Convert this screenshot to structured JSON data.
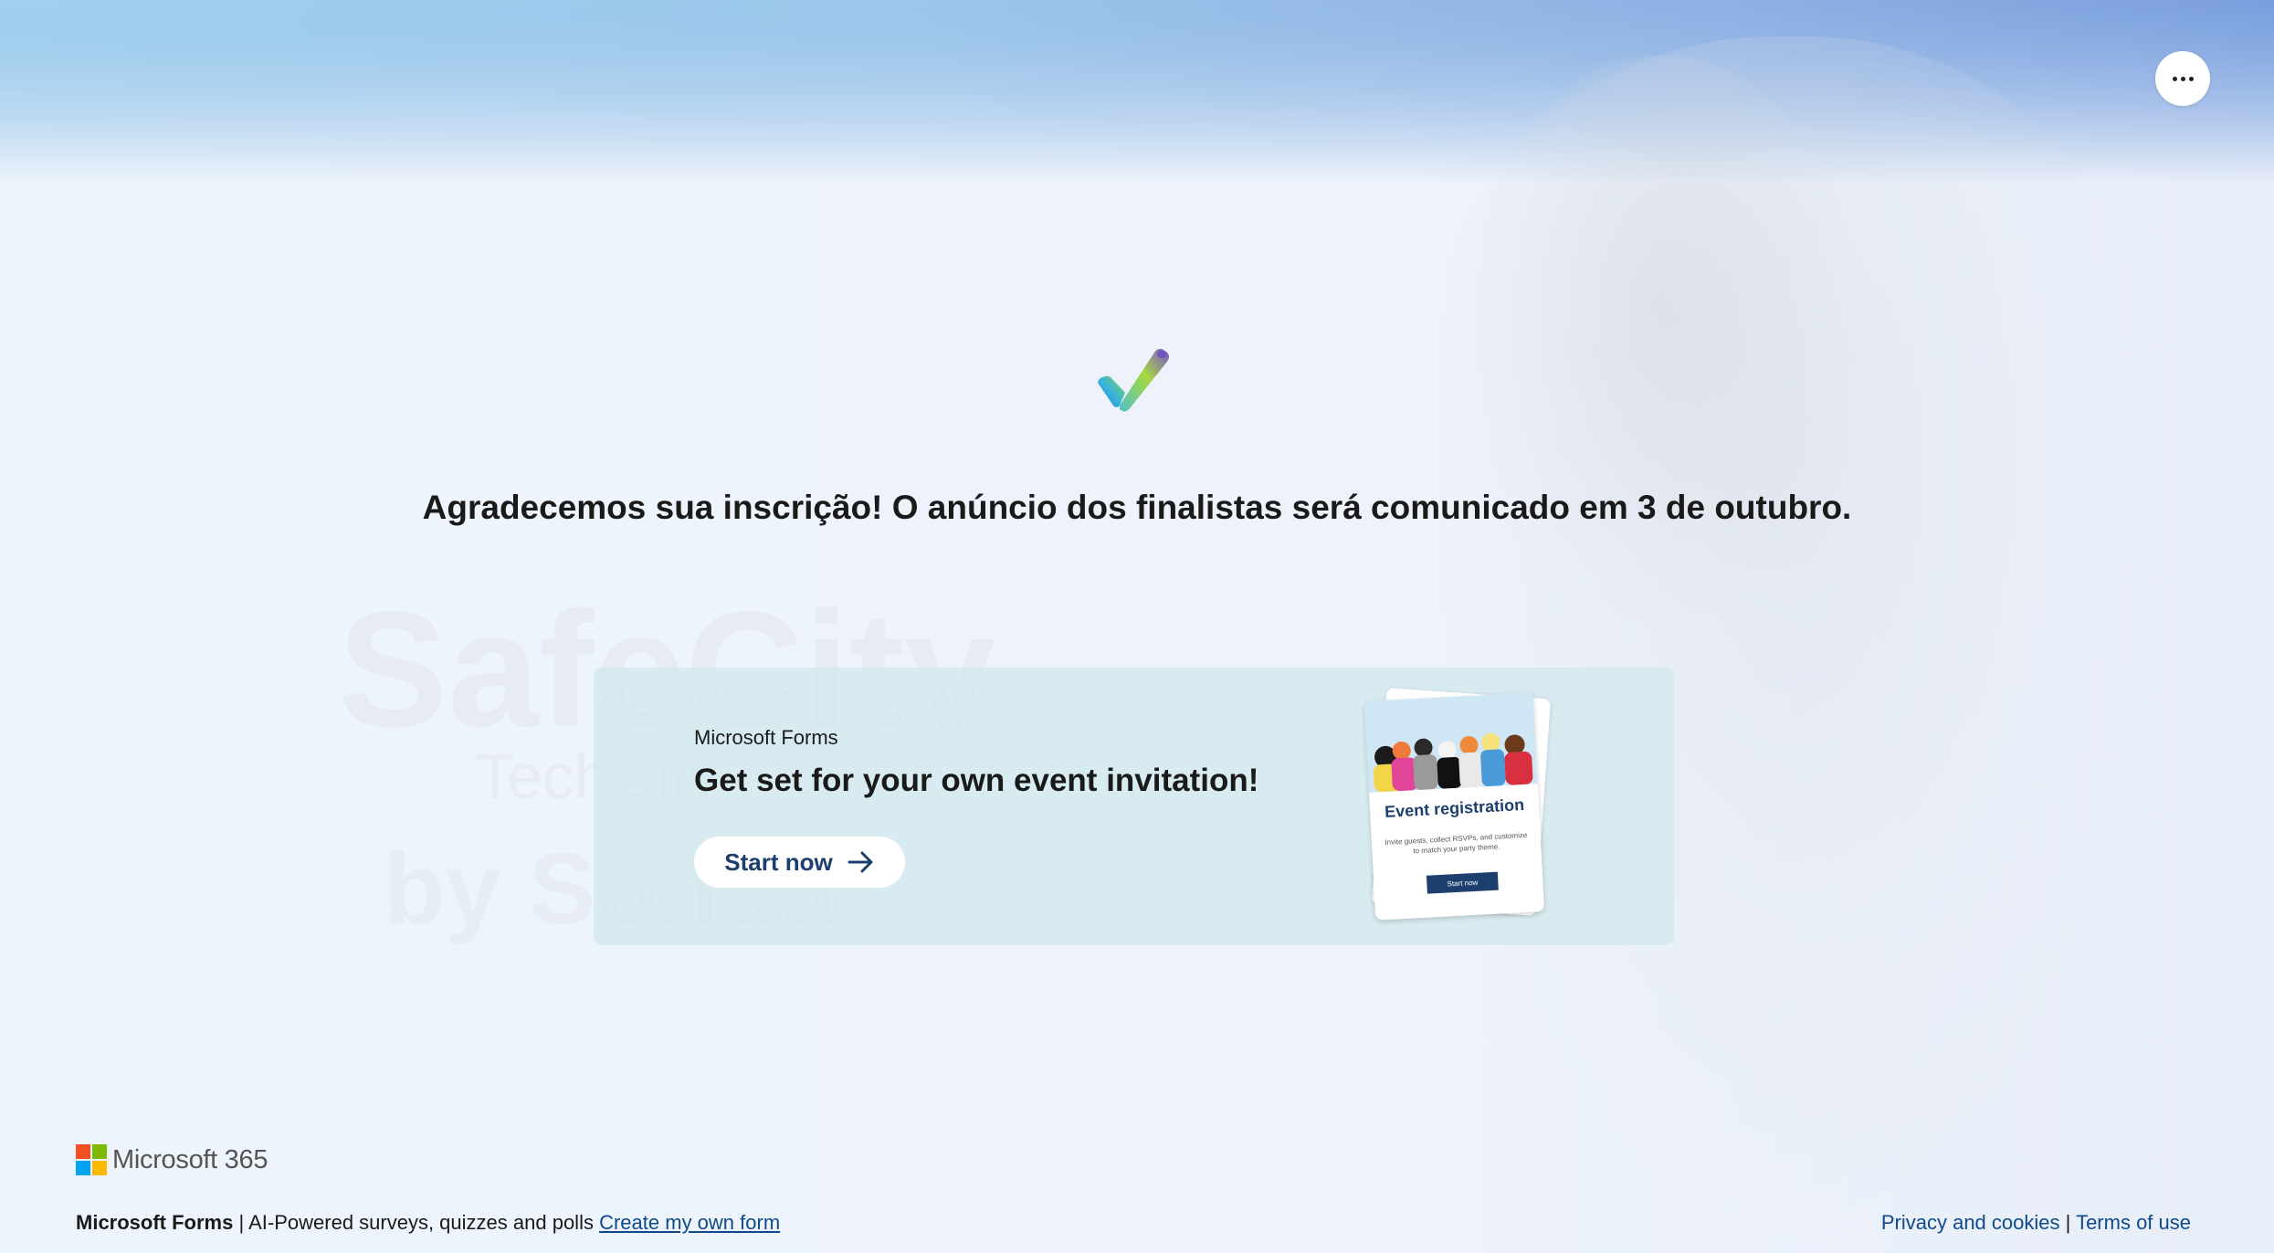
{
  "header": {
    "more_icon": "more-horizontal-icon"
  },
  "confirmation": {
    "icon": "checkmark-icon",
    "message": "Agradecemos sua inscrição! O anúncio dos finalistas será comunicado em 3 de outubro."
  },
  "promo": {
    "brand": "Microsoft Forms",
    "title": "Get set for your own event invitation!",
    "button_label": "Start now",
    "button_icon": "arrow-right-icon",
    "card": {
      "title": "Event registration",
      "description": "Invite guests, collect RSVPs, and customize to match your party theme.",
      "button_label": "Start now"
    }
  },
  "footer": {
    "logo_text": "Microsoft 365",
    "brand": "Microsoft Forms",
    "separator": "|",
    "tagline": "AI-Powered surveys, quizzes and polls",
    "create_link": "Create my own form",
    "privacy_link": "Privacy and cookies",
    "terms_link": "Terms of use"
  },
  "colors": {
    "accent": "#1d3f6e",
    "link": "#0f4a8a",
    "promo_bg": "#d0e8ec",
    "logo_red": "#f25022",
    "logo_green": "#7fba00",
    "logo_blue": "#00a4ef",
    "logo_yellow": "#ffb900"
  }
}
